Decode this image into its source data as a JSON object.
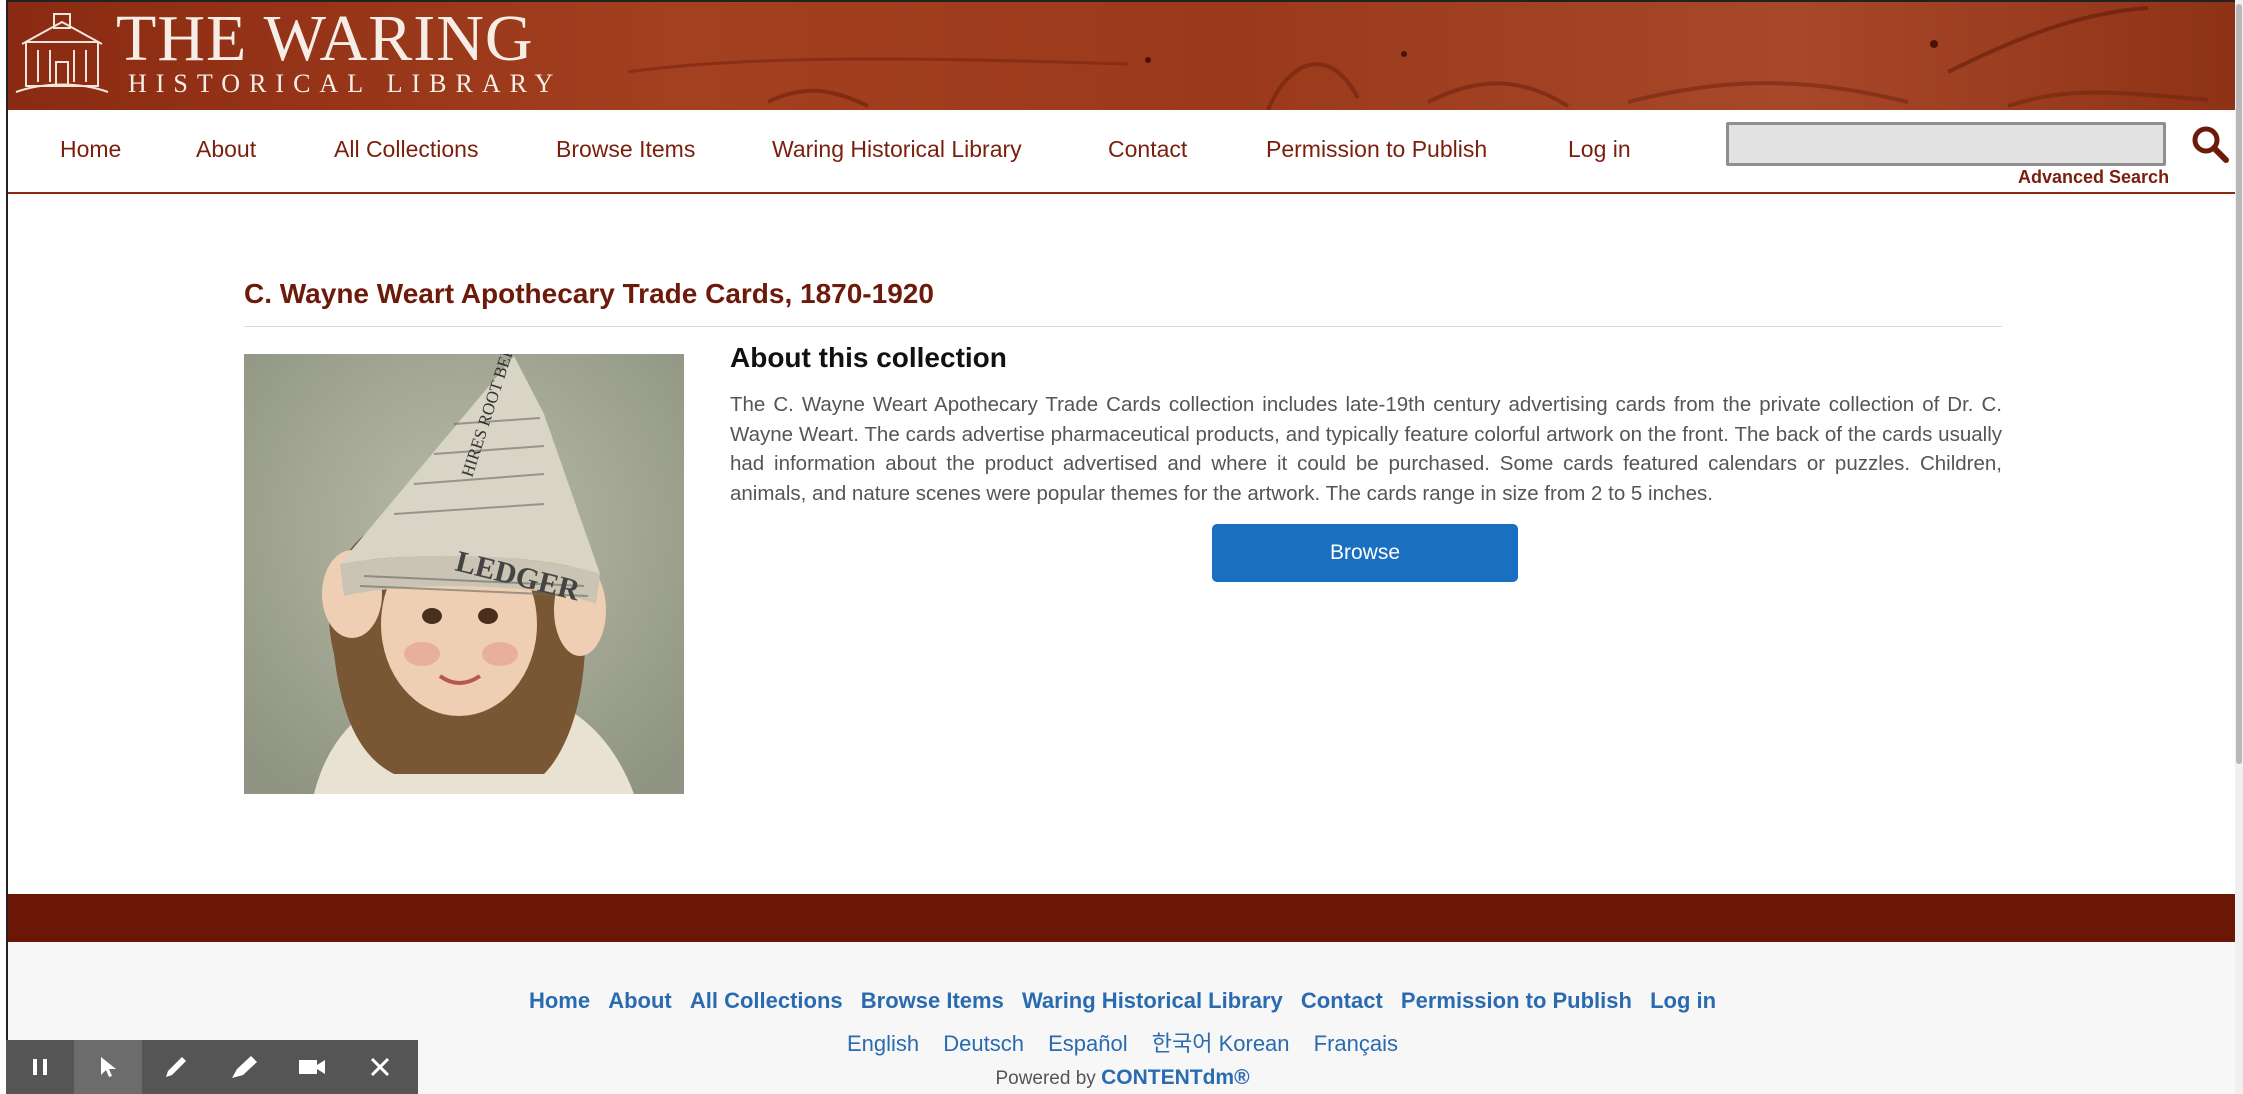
{
  "logo": {
    "title": "THE WARING",
    "subtitle": "HISTORICAL LIBRARY"
  },
  "nav": {
    "items": [
      "Home",
      "About",
      "All Collections",
      "Browse Items",
      "Waring Historical Library",
      "Contact",
      "Permission to Publish",
      "Log in"
    ],
    "search_value": "",
    "advanced_search": "Advanced Search"
  },
  "collection": {
    "title": "C. Wayne Weart Apothecary Trade Cards, 1870-1920",
    "about_heading": "About this collection",
    "about_text": "The C. Wayne Weart Apothecary Trade Cards collection includes late-19th century advertising cards from the private collection of Dr. C. Wayne Weart. The cards advertise pharmaceutical products, and typically feature colorful artwork on the front. The back of the cards usually had information about the product advertised and where it could be purchased. Some cards featured calendars or puzzles. Children, animals, and nature scenes were popular themes for the artwork. The cards range in size from 2 to 5 inches.",
    "browse_label": "Browse",
    "image_text": {
      "hat_top": "HIRES ROOT BEER",
      "hat_band": "LEDGER"
    }
  },
  "footer": {
    "links": [
      "Home",
      "About",
      "All Collections",
      "Browse Items",
      "Waring Historical Library",
      "Contact",
      "Permission to Publish",
      "Log in"
    ],
    "languages": [
      "English",
      "Deutsch",
      "Español",
      "한국어 Korean",
      "Français"
    ],
    "powered_prefix": "Powered by",
    "powered_brand": "CONTENTdm®"
  },
  "colors": {
    "brand": "#8a2a12",
    "nav_text": "#7a1f0c",
    "link_blue": "#2a6bb0",
    "button_blue": "#1a6fc0",
    "footer_bar": "#6b1606"
  },
  "icons": [
    "search-icon",
    "pause-icon",
    "pointer-icon",
    "pen-icon",
    "highlighter-icon",
    "camera-icon",
    "close-icon"
  ]
}
